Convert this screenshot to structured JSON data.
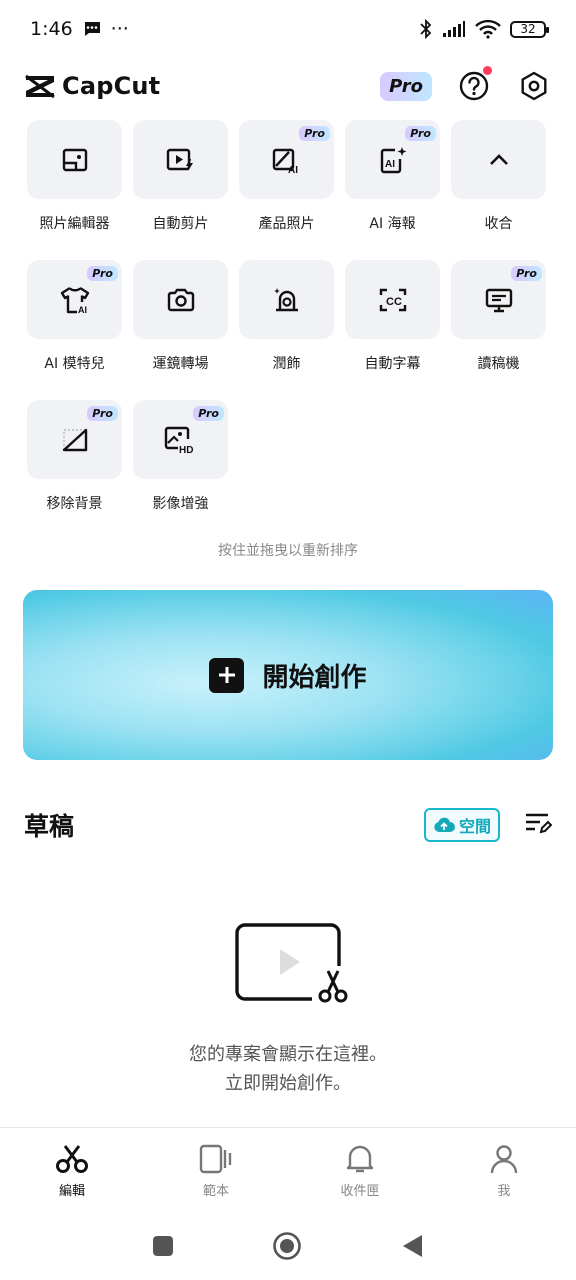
{
  "status_bar": {
    "time": "1:46",
    "more": "···",
    "battery": "32"
  },
  "header": {
    "app_name": "CapCut",
    "pro_label": "Pro"
  },
  "tools": [
    {
      "label": "照片編輯器",
      "icon": "photo-editor-icon",
      "pro": ""
    },
    {
      "label": "自動剪片",
      "icon": "auto-cut-icon",
      "pro": ""
    },
    {
      "label": "產品照片",
      "icon": "product-photo-icon",
      "pro": "Pro"
    },
    {
      "label": "AI 海報",
      "icon": "ai-poster-icon",
      "pro": "Pro"
    },
    {
      "label": "收合",
      "icon": "chevron-up-icon",
      "pro": ""
    },
    {
      "label": "AI 模特兒",
      "icon": "ai-model-icon",
      "pro": "Pro"
    },
    {
      "label": "運鏡轉場",
      "icon": "camera-icon",
      "pro": ""
    },
    {
      "label": "潤飾",
      "icon": "retouch-icon",
      "pro": ""
    },
    {
      "label": "自動字幕",
      "icon": "captions-icon",
      "pro": ""
    },
    {
      "label": "讀稿機",
      "icon": "teleprompter-icon",
      "pro": "Pro"
    },
    {
      "label": "移除背景",
      "icon": "remove-bg-icon",
      "pro": "Pro"
    },
    {
      "label": "影像增強",
      "icon": "hd-enhance-icon",
      "pro": "Pro"
    }
  ],
  "reorder_hint": "按住並拖曳以重新排序",
  "create": {
    "label": "開始創作"
  },
  "drafts": {
    "title": "草稿",
    "space_label": "空間",
    "empty_line1": "您的專案會顯示在這裡。",
    "empty_line2": "立即開始創作。"
  },
  "bottom_nav": [
    {
      "label": "編輯",
      "icon": "scissors-icon",
      "active": true
    },
    {
      "label": "範本",
      "icon": "template-icon",
      "active": false
    },
    {
      "label": "收件匣",
      "icon": "bell-icon",
      "active": false
    },
    {
      "label": "我",
      "icon": "person-icon",
      "active": false
    }
  ],
  "colors": {
    "accent_teal": "#12a9b9",
    "notification_dot": "#ff3b5c",
    "tile_bg": "#f0f2f5"
  }
}
